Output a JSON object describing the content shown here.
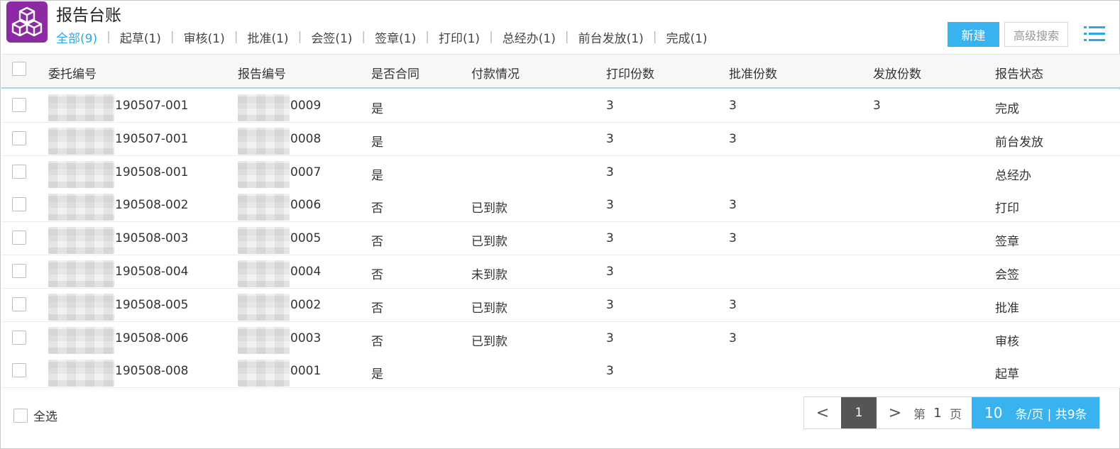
{
  "header": {
    "title": "报告台账",
    "tabs": [
      {
        "label": "全部(9)",
        "active": true
      },
      {
        "label": "起草(1)"
      },
      {
        "label": "审核(1)"
      },
      {
        "label": "批准(1)"
      },
      {
        "label": "会签(1)"
      },
      {
        "label": "签章(1)"
      },
      {
        "label": "打印(1)"
      },
      {
        "label": "总经办(1)"
      },
      {
        "label": "前台发放(1)"
      },
      {
        "label": "完成(1)"
      }
    ],
    "tab_separator": "|",
    "new_button": "新建",
    "advanced_search_button": "高级搜索"
  },
  "table": {
    "columns": [
      "委托编号",
      "报告编号",
      "是否合同",
      "付款情况",
      "打印份数",
      "批准份数",
      "发放份数",
      "报告状态"
    ],
    "rows": [
      {
        "entrust_no": "190507-001",
        "report_no": "0009",
        "contract": "是",
        "payment": "",
        "print": "3",
        "approve": "3",
        "issue": "3",
        "status": "完成"
      },
      {
        "entrust_no": "190507-001",
        "report_no": "0008",
        "contract": "是",
        "payment": "",
        "print": "3",
        "approve": "3",
        "issue": "",
        "status": "前台发放"
      },
      {
        "entrust_no": "190508-001",
        "report_no": "0007",
        "contract": "是",
        "payment": "",
        "print": "3",
        "approve": "",
        "issue": "",
        "status": "总经办"
      },
      {
        "entrust_no": "190508-002",
        "report_no": "0006",
        "contract": "否",
        "payment": "已到款",
        "print": "3",
        "approve": "3",
        "issue": "",
        "status": "打印"
      },
      {
        "entrust_no": "190508-003",
        "report_no": "0005",
        "contract": "否",
        "payment": "已到款",
        "print": "3",
        "approve": "3",
        "issue": "",
        "status": "签章"
      },
      {
        "entrust_no": "190508-004",
        "report_no": "0004",
        "contract": "否",
        "payment": "未到款",
        "print": "3",
        "approve": "",
        "issue": "",
        "status": "会签"
      },
      {
        "entrust_no": "190508-005",
        "report_no": "0002",
        "contract": "否",
        "payment": "已到款",
        "print": "3",
        "approve": "3",
        "issue": "",
        "status": "批准"
      },
      {
        "entrust_no": "190508-006",
        "report_no": "0003",
        "contract": "否",
        "payment": "已到款",
        "print": "3",
        "approve": "3",
        "issue": "",
        "status": "审核"
      },
      {
        "entrust_no": "190508-008",
        "report_no": "0001",
        "contract": "是",
        "payment": "",
        "print": "3",
        "approve": "",
        "issue": "",
        "status": "起草"
      }
    ]
  },
  "footer": {
    "select_all": "全选",
    "pager": {
      "prev": "<",
      "current": "1",
      "next": ">",
      "page_prefix": "第",
      "page_value": "1",
      "page_suffix": "页",
      "page_size": "10",
      "summary": "条/页 | 共9条"
    }
  },
  "colors": {
    "accent": "#39b3f0",
    "active_tab": "#2da7e8",
    "logo": "#8b2aa3",
    "pager_current": "#555555"
  },
  "icons": {
    "logo": "cubes-icon",
    "menu": "list-menu-icon"
  }
}
